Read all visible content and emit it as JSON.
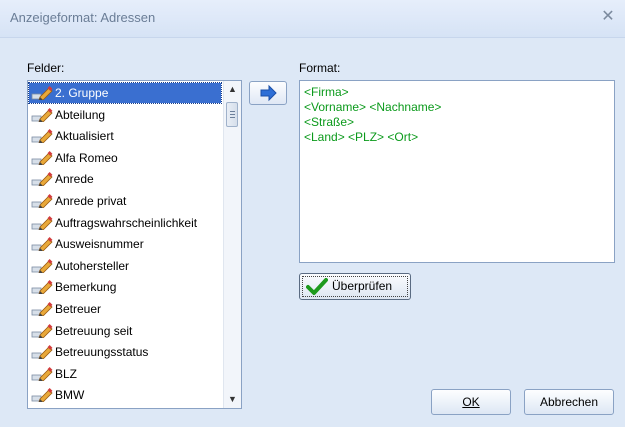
{
  "window": {
    "title": "Anzeigeformat: Adressen",
    "close_glyph": "✕"
  },
  "fields_label": "Felder:",
  "format_label": "Format:",
  "fields": [
    {
      "label": "2. Gruppe",
      "selected": true
    },
    {
      "label": "Abteilung"
    },
    {
      "label": "Aktualisiert"
    },
    {
      "label": "Alfa Romeo"
    },
    {
      "label": "Anrede"
    },
    {
      "label": "Anrede privat"
    },
    {
      "label": "Auftragswahrscheinlichkeit"
    },
    {
      "label": "Ausweisnummer"
    },
    {
      "label": "Autohersteller"
    },
    {
      "label": "Bemerkung"
    },
    {
      "label": "Betreuer"
    },
    {
      "label": "Betreuung seit"
    },
    {
      "label": "Betreuungsstatus"
    },
    {
      "label": "BLZ"
    },
    {
      "label": "BMW"
    }
  ],
  "format_lines": [
    "<Firma>",
    "<Vorname> <Nachname>",
    "<Straße>",
    "<Land> <PLZ> <Ort>"
  ],
  "buttons": {
    "check": "Überprüfen",
    "ok": "OK",
    "cancel": "Abbrechen"
  },
  "colors": {
    "format_text": "#0b9a1b",
    "selection": "#3a6fd0",
    "dialog_bg": "#dde8f6"
  },
  "icons": {
    "field": "field-edit-icon",
    "add": "arrow-right-icon",
    "check": "checkmark-icon"
  }
}
